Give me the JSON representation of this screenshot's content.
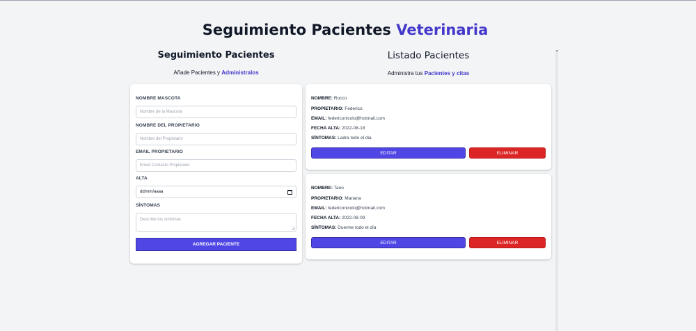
{
  "header": {
    "title_main": "Seguimiento Pacientes",
    "title_accent": "Veterinaria"
  },
  "form_section": {
    "heading": "Seguimiento Pacientes",
    "subtitle": "Añade Pacientes y",
    "subtitle_accent": "Administralos",
    "fields": [
      {
        "label": "Nombre Mascota",
        "placeholder": "Nombre de la Mascota"
      },
      {
        "label": "Nombre del Propietario",
        "placeholder": "Nombre del Propietario"
      },
      {
        "label": "Email Propietario",
        "placeholder": "Email Contacto Propietario"
      },
      {
        "label": "Alta",
        "value": "dd/mm/aaaa"
      },
      {
        "label": "Síntomas",
        "placeholder": "Describe los síntomas"
      }
    ],
    "submit_label": "Agregar Paciente"
  },
  "list_section": {
    "heading": "Listado Pacientes",
    "subtitle": "Administra tus",
    "subtitle_accent": "Pacientes y citas",
    "labels": {
      "name": "Nombre:",
      "owner": "Propietario:",
      "email": "Email:",
      "date": "Fecha Alta:",
      "symptoms": "Síntomas:"
    },
    "edit_label": "Editar",
    "delete_label": "Eliminar",
    "patients": [
      {
        "name": "Rocco",
        "owner": "Federico",
        "email": "federiconicolo@hotmail.com",
        "date": "2022-08-18",
        "symptoms": "Ladra todo el dia"
      },
      {
        "name": "Tano",
        "owner": "Mariana",
        "email": "federiconicolo@hotmail.com",
        "date": "2022-08-09",
        "symptoms": "Duerme todo el día"
      }
    ]
  },
  "colors": {
    "accent": "#4338ca",
    "primary_button": "#4f46e5",
    "danger_button": "#dc2626",
    "background": "#f3f4f6"
  },
  "icons": {
    "date_field": "calendar-icon",
    "textarea": "resize-handle-icon"
  }
}
